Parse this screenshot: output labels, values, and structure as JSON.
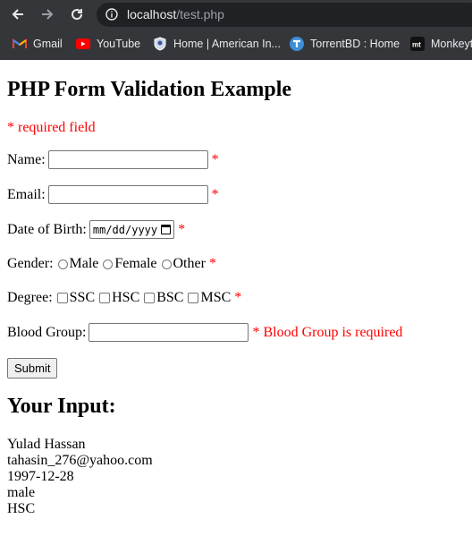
{
  "browser": {
    "url_host": "localhost",
    "url_path": "/test.php",
    "bookmarks": [
      {
        "label": "Gmail",
        "icon": "gmail-icon"
      },
      {
        "label": "YouTube",
        "icon": "youtube-icon"
      },
      {
        "label": "Home | American In...",
        "icon": "shield-icon"
      },
      {
        "label": "TorrentBD : Home",
        "icon": "torrentbd-icon"
      },
      {
        "label": "Monkeyt",
        "icon": "monkeytype-icon"
      }
    ]
  },
  "form": {
    "title": "PHP Form Validation Example",
    "required_note": "* required field",
    "name_label": "Name:",
    "email_label": "Email:",
    "dob_label": "Date of Birth:",
    "dob_placeholder": "mm/dd/yyyy",
    "gender_label": "Gender:",
    "gender_options": [
      "Male",
      "Female",
      "Other"
    ],
    "degree_label": "Degree:",
    "degree_options": [
      "SSC",
      "HSC",
      "BSC",
      "MSC"
    ],
    "blood_label": "Blood Group:",
    "blood_error": "* Blood Group is required",
    "asterisk": "*",
    "submit_label": "Submit"
  },
  "output": {
    "title": "Your Input:",
    "lines": [
      "Yulad Hassan",
      "tahasin_276@yahoo.com",
      "1997-12-28",
      "male",
      "HSC"
    ]
  },
  "colors": {
    "error": "#ff0000",
    "chrome": "#35363a"
  }
}
